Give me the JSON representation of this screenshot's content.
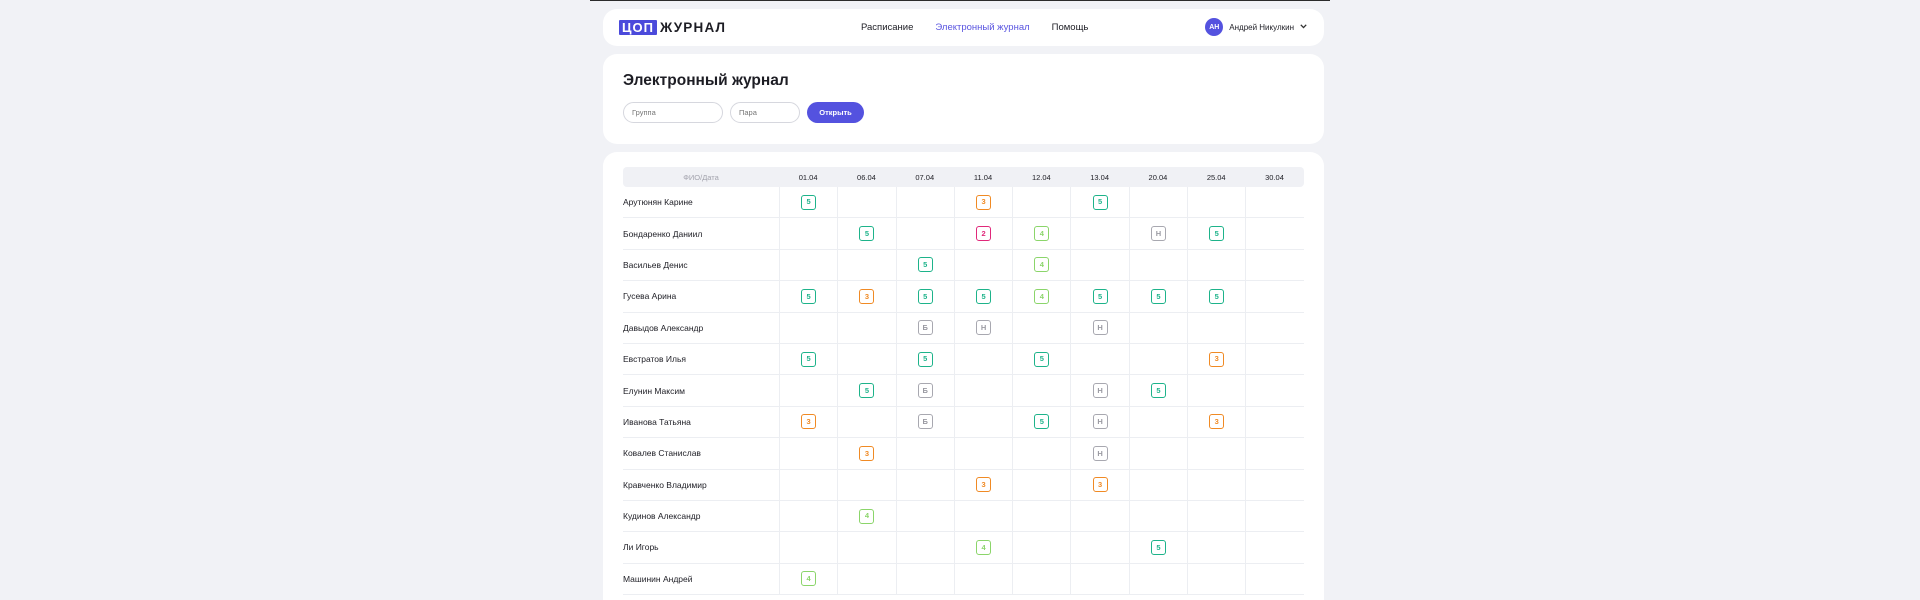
{
  "header": {
    "logo": {
      "box": "ЦОП",
      "text": "ЖУРНАЛ"
    },
    "nav": [
      {
        "label": "Расписание",
        "active": false
      },
      {
        "label": "Электронный журнал",
        "active": true
      },
      {
        "label": "Помощь",
        "active": false
      }
    ],
    "user": {
      "initials": "АН",
      "name": "Андрей Никулкин"
    }
  },
  "filters": {
    "title": "Электронный журнал",
    "group_placeholder": "Группа",
    "pair_placeholder": "Пара",
    "open_label": "Открыть"
  },
  "journal": {
    "name_header": "ФИО/Дата",
    "dates": [
      "01.04",
      "06.04",
      "07.04",
      "11.04",
      "12.04",
      "13.04",
      "20.04",
      "25.04",
      "30.04"
    ],
    "rows": [
      {
        "name": "Арутюнян Карине",
        "marks": [
          "5",
          "",
          "",
          "3",
          "",
          "5",
          "",
          "",
          ""
        ]
      },
      {
        "name": "Бондаренко Даниил",
        "marks": [
          "",
          "5",
          "",
          "2",
          "4",
          "",
          "Н",
          "5",
          ""
        ]
      },
      {
        "name": "Васильев Денис",
        "marks": [
          "",
          "",
          "5",
          "",
          "4",
          "",
          "",
          "",
          ""
        ]
      },
      {
        "name": "Гусева Арина",
        "marks": [
          "5",
          "3",
          "5",
          "5",
          "4",
          "5",
          "5",
          "5",
          ""
        ]
      },
      {
        "name": "Давыдов Александр",
        "marks": [
          "",
          "",
          "Б",
          "Н",
          "",
          "Н",
          "",
          "",
          ""
        ]
      },
      {
        "name": "Евстратов Илья",
        "marks": [
          "5",
          "",
          "5",
          "",
          "5",
          "",
          "",
          "3",
          ""
        ]
      },
      {
        "name": "Елунин Максим",
        "marks": [
          "",
          "5",
          "Б",
          "",
          "",
          "Н",
          "5",
          "",
          ""
        ]
      },
      {
        "name": "Иванова Татьяна",
        "marks": [
          "3",
          "",
          "Б",
          "",
          "5",
          "Н",
          "",
          "3",
          ""
        ]
      },
      {
        "name": "Ковалев Станислав",
        "marks": [
          "",
          "3",
          "",
          "",
          "",
          "Н",
          "",
          "",
          ""
        ]
      },
      {
        "name": "Кравченко Владимир",
        "marks": [
          "",
          "",
          "",
          "3",
          "",
          "3",
          "",
          "",
          ""
        ]
      },
      {
        "name": "Кудинов Александр",
        "marks": [
          "",
          "4",
          "",
          "",
          "",
          "",
          "",
          "",
          ""
        ]
      },
      {
        "name": "Ли Игорь",
        "marks": [
          "",
          "",
          "",
          "4",
          "",
          "",
          "5",
          "",
          ""
        ]
      },
      {
        "name": "Машинин Андрей",
        "marks": [
          "4",
          "",
          "",
          "",
          "",
          "",
          "",
          "",
          ""
        ]
      }
    ]
  },
  "colors": {
    "accent": "#5452df",
    "grade5": "#1db38a",
    "grade4": "#8bd56a",
    "grade3": "#f08a24",
    "grade2": "#e0287a",
    "absent": "#a8a8b0"
  }
}
